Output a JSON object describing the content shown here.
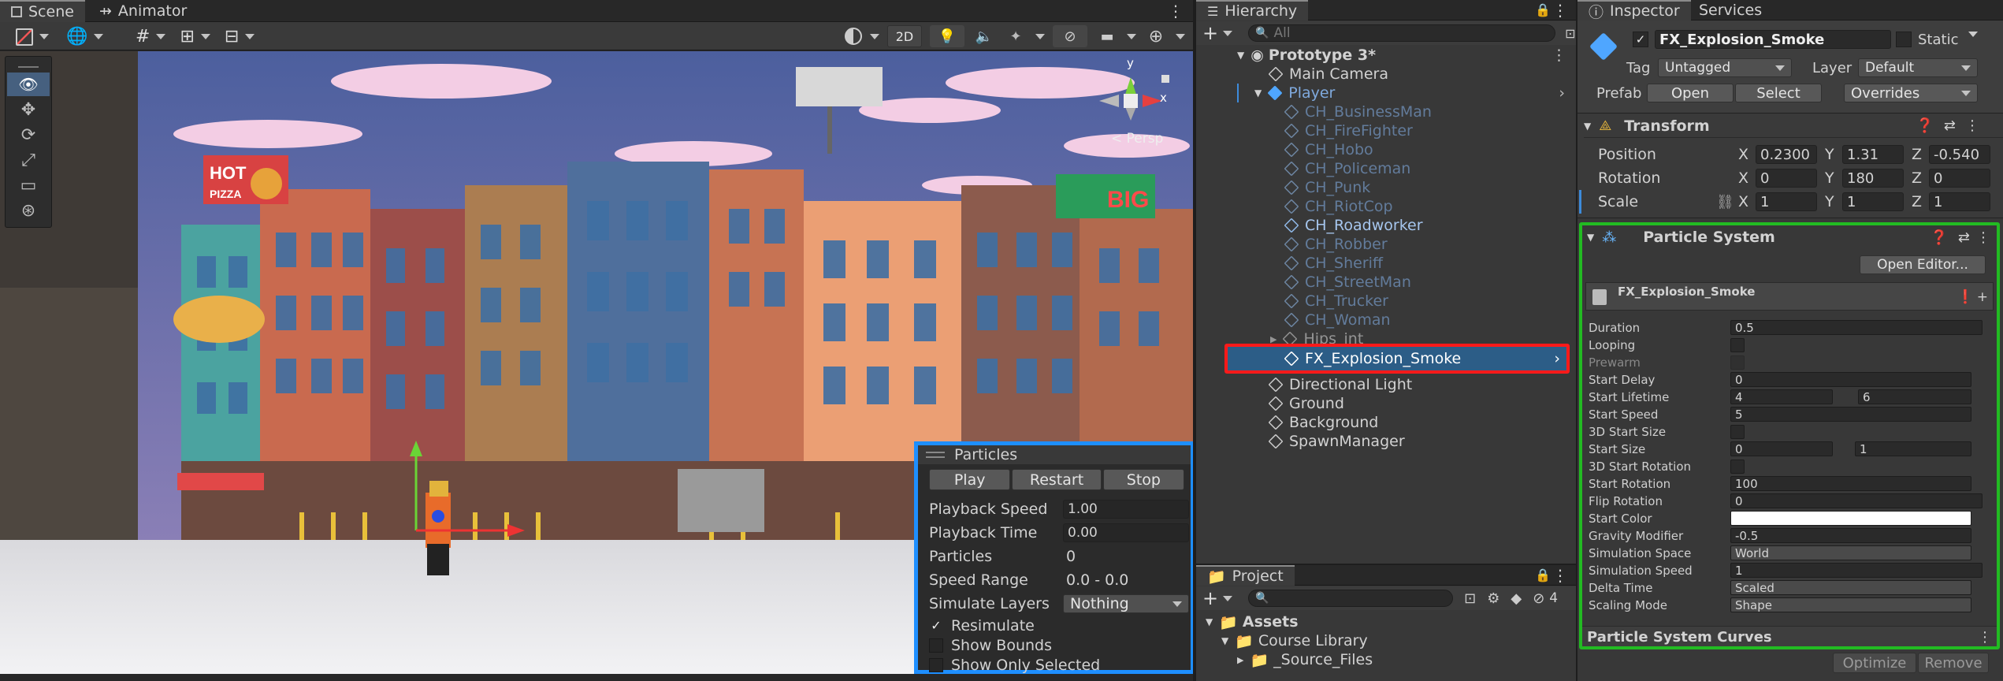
{
  "scene_tabs": {
    "scene": "Scene",
    "animator": "Animator"
  },
  "scene_toolbar": {
    "mode_2d": "2D"
  },
  "gizmo": {
    "axis_y": "y",
    "axis_x": "x",
    "persp": "< Persp"
  },
  "billboards": {
    "hot_pizza_line1": "HOT",
    "hot_pizza_line2": "PIZZA",
    "big": "BIG"
  },
  "particles_overlay": {
    "title": "Particles",
    "play": "Play",
    "restart": "Restart",
    "stop": "Stop",
    "rows": [
      {
        "label": "Playback Speed",
        "value": "1.00"
      },
      {
        "label": "Playback Time",
        "value": "0.00"
      },
      {
        "label": "Particles",
        "value": "0"
      },
      {
        "label": "Speed Range",
        "value": "0.0 - 0.0"
      },
      {
        "label": "Simulate Layers",
        "value": "Nothing"
      }
    ],
    "resimulate": "Resimulate",
    "show_bounds": "Show Bounds",
    "show_only_selected": "Show Only Selected"
  },
  "hierarchy": {
    "tab": "Hierarchy",
    "search_placeholder": "All",
    "scene": "Prototype 3*",
    "items": [
      {
        "label": "Main Camera"
      },
      {
        "label": "Player"
      },
      {
        "label": "CH_BusinessMan"
      },
      {
        "label": "CH_FireFighter"
      },
      {
        "label": "CH_Hobo"
      },
      {
        "label": "CH_Policeman"
      },
      {
        "label": "CH_Punk"
      },
      {
        "label": "CH_RiotCop"
      },
      {
        "label": "CH_Roadworker"
      },
      {
        "label": "CH_Robber"
      },
      {
        "label": "CH_Sheriff"
      },
      {
        "label": "CH_StreetMan"
      },
      {
        "label": "CH_Trucker"
      },
      {
        "label": "CH_Woman"
      },
      {
        "label": "Hips_int"
      },
      {
        "label": "FX_Explosion_Smoke"
      },
      {
        "label": "Directional Light"
      },
      {
        "label": "Ground"
      },
      {
        "label": "Background"
      },
      {
        "label": "SpawnManager"
      }
    ]
  },
  "project": {
    "tab": "Project",
    "hidden_count": "4",
    "items": [
      {
        "label": "Assets"
      },
      {
        "label": "Course Library"
      },
      {
        "label": "_Source_Files"
      }
    ]
  },
  "inspector": {
    "tab": "Inspector",
    "services_tab": "Services",
    "object_name": "FX_Explosion_Smoke",
    "static_label": "Static",
    "tag_label": "Tag",
    "tag_value": "Untagged",
    "layer_label": "Layer",
    "layer_value": "Default",
    "prefab_label": "Prefab",
    "open": "Open",
    "select": "Select",
    "overrides": "Overrides",
    "transform": {
      "title": "Transform",
      "position_label": "Position",
      "rotation_label": "Rotation",
      "scale_label": "Scale",
      "x": "X",
      "y": "Y",
      "z": "Z",
      "position": [
        "0.2300",
        "1.31",
        "-0.540"
      ],
      "rotation": [
        "0",
        "180",
        "0"
      ],
      "scale": [
        "1",
        "1",
        "1"
      ]
    },
    "particle_system": {
      "title": "Particle System",
      "open_editor": "Open Editor...",
      "module_name": "FX_Explosion_Smoke",
      "rows": {
        "duration": {
          "label": "Duration",
          "value": "0.5"
        },
        "looping": {
          "label": "Looping"
        },
        "prewarm": {
          "label": "Prewarm"
        },
        "start_delay": {
          "label": "Start Delay",
          "value": "0"
        },
        "start_lifetime": {
          "label": "Start Lifetime",
          "a": "4",
          "b": "6"
        },
        "start_speed": {
          "label": "Start Speed",
          "value": "5"
        },
        "start_size_3d": {
          "label": "3D Start Size"
        },
        "start_size": {
          "label": "Start Size",
          "a": "0",
          "b": "1"
        },
        "start_rotation_3d": {
          "label": "3D Start Rotation"
        },
        "start_rotation": {
          "label": "Start Rotation",
          "value": "100"
        },
        "flip_rotation": {
          "label": "Flip Rotation",
          "value": "0"
        },
        "start_color": {
          "label": "Start Color",
          "color": "#ffffff"
        },
        "gravity_modifier": {
          "label": "Gravity Modifier",
          "value": "-0.5"
        },
        "simulation_space": {
          "label": "Simulation Space",
          "value": "World"
        },
        "simulation_speed": {
          "label": "Simulation Speed",
          "value": "1"
        },
        "delta_time": {
          "label": "Delta Time",
          "value": "Scaled"
        },
        "scaling_mode": {
          "label": "Scaling Mode",
          "value": "Shape"
        }
      },
      "curves": "Particle System Curves"
    },
    "optimize": "Optimize",
    "remove": "Remove"
  },
  "colors": {
    "highlight_red": "#ff1a1a",
    "highlight_blue": "#1e8fff",
    "highlight_green": "#22bb22",
    "selection": "#2c5d87",
    "accent": "#46607f"
  }
}
